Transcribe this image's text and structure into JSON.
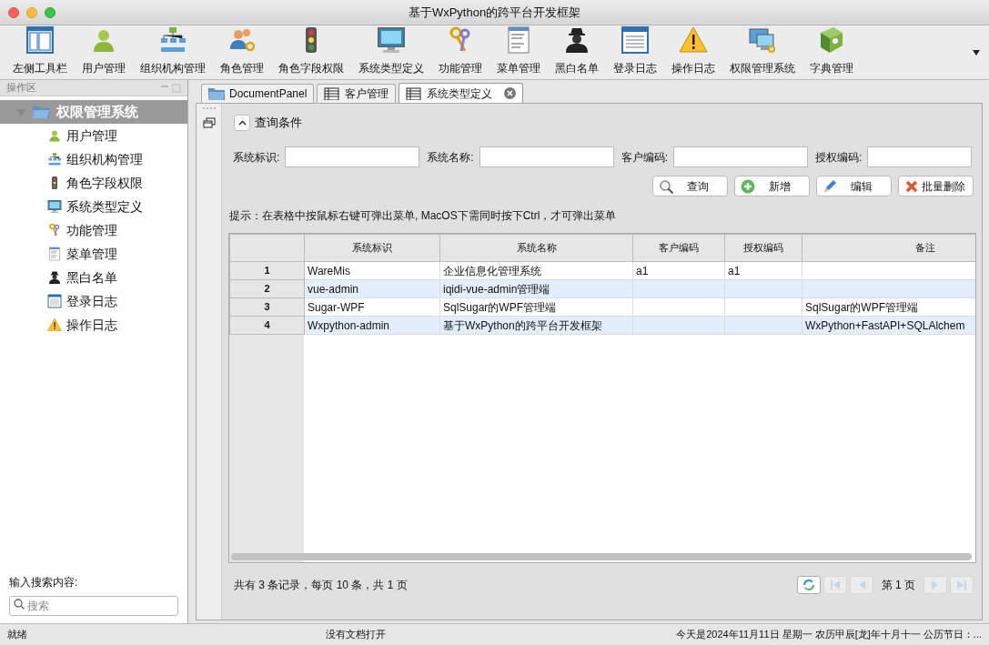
{
  "window": {
    "title": "基于WxPython的跨平台开发框架"
  },
  "toolbar": [
    {
      "label": "左侧工具栏"
    },
    {
      "label": "用户管理"
    },
    {
      "label": "组织机构管理"
    },
    {
      "label": "角色管理"
    },
    {
      "label": "角色字段权限"
    },
    {
      "label": "系统类型定义"
    },
    {
      "label": "功能管理"
    },
    {
      "label": "菜单管理"
    },
    {
      "label": "黑白名单"
    },
    {
      "label": "登录日志"
    },
    {
      "label": "操作日志"
    },
    {
      "label": "权限管理系统"
    },
    {
      "label": "字典管理"
    }
  ],
  "sidebar": {
    "title": "操作区",
    "tree": [
      {
        "label": "权限管理系统",
        "selected": true,
        "expanded": true,
        "children": [
          {
            "label": "用户管理",
            "selected": false
          },
          {
            "label": "组织机构管理",
            "selected": false
          },
          {
            "label": "角色字段权限",
            "selected": false
          },
          {
            "label": "系统类型定义",
            "selected": false
          },
          {
            "label": "功能管理",
            "selected": false
          },
          {
            "label": "菜单管理",
            "selected": false
          },
          {
            "label": "黑白名单",
            "selected": false
          },
          {
            "label": "登录日志",
            "selected": false
          },
          {
            "label": "操作日志",
            "selected": false
          }
        ]
      }
    ],
    "search_label": "输入搜索内容:",
    "search": {
      "placeholder": "搜索"
    }
  },
  "tabs": [
    {
      "label": "DocumentPanel",
      "selected": false,
      "kind": "folder"
    },
    {
      "label": "客户管理",
      "selected": false,
      "kind": "grid"
    },
    {
      "label": "系统类型定义",
      "selected": true,
      "kind": "grid"
    }
  ],
  "query": {
    "title": "查询条件",
    "expanded": true,
    "fields": [
      {
        "label": "系统标识:"
      },
      {
        "label": "系统名称:"
      },
      {
        "label": "客户编码:"
      },
      {
        "label": "授权编码:"
      }
    ],
    "buttons": [
      {
        "label": "查询",
        "kind": "search"
      },
      {
        "label": "新增",
        "kind": "add"
      },
      {
        "label": "编辑",
        "kind": "edit"
      },
      {
        "label": "批量删除",
        "kind": "delete"
      }
    ]
  },
  "hint": "提示：在表格中按鼠标右键可弹出菜单, MacOS下需同时按下Ctrl，才可弹出菜单",
  "table": {
    "columns": [
      "系统标识",
      "系统名称",
      "客户编码",
      "授权编码",
      "备注"
    ],
    "rows": [
      {
        "index": "1",
        "cells": [
          "WareMis",
          "企业信息化管理系统",
          "a1",
          "a1",
          ""
        ]
      },
      {
        "index": "2",
        "cells": [
          "vue-admin",
          "iqidi-vue-admin管理端",
          "",
          "",
          ""
        ]
      },
      {
        "index": "3",
        "cells": [
          "Sugar-WPF",
          "SqlSugar的WPF管理端",
          "",
          "",
          "SqlSugar的WPF管理端"
        ]
      },
      {
        "index": "4",
        "cells": [
          "Wxpython-admin",
          "基于WxPython的跨平台开发框架",
          "",
          "",
          "WxPython+FastAPI+SQLAlchem"
        ]
      }
    ]
  },
  "pager": {
    "summary": "共有 3 条记录，每页 10 条，共 1 页",
    "page": "第 1 页",
    "first_disabled": true,
    "prev_disabled": true,
    "next_disabled": true,
    "last_disabled": true
  },
  "status_bar": [
    "就绪",
    "没有文档打开",
    "今天是2024年11月11日 星期一 农历甲辰[龙]年十月十一 公历节日：..."
  ]
}
